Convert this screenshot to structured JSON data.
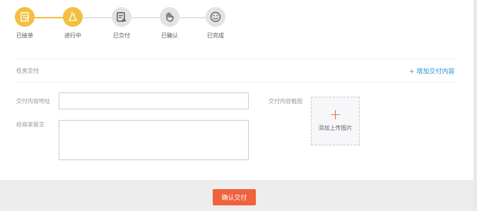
{
  "steps": [
    {
      "label": "已接单",
      "icon": "order-received-icon",
      "state": "done"
    },
    {
      "label": "进行中",
      "icon": "in-progress-icon",
      "state": "done"
    },
    {
      "label": "已交付",
      "icon": "delivered-icon",
      "state": "pending"
    },
    {
      "label": "已确认",
      "icon": "confirmed-icon",
      "state": "pending"
    },
    {
      "label": "已完成",
      "icon": "completed-icon",
      "state": "pending"
    }
  ],
  "colors": {
    "step_active": "#f3bf3f",
    "step_inactive": "#e3e3e3",
    "accent": "#f0623c",
    "link": "#2a8fd6"
  },
  "task": {
    "section_title": "任务交付",
    "add_link": "+ 增加交付内容"
  },
  "form": {
    "content_address_label": "交付内容地址",
    "content_address_value": "",
    "merchant_message_label": "给商家留言",
    "merchant_message_value": "",
    "screenshot_label": "交付内容截图",
    "upload_plus": "+",
    "upload_text": "添加上传图片"
  },
  "footer": {
    "confirm_label": "确认交付"
  }
}
